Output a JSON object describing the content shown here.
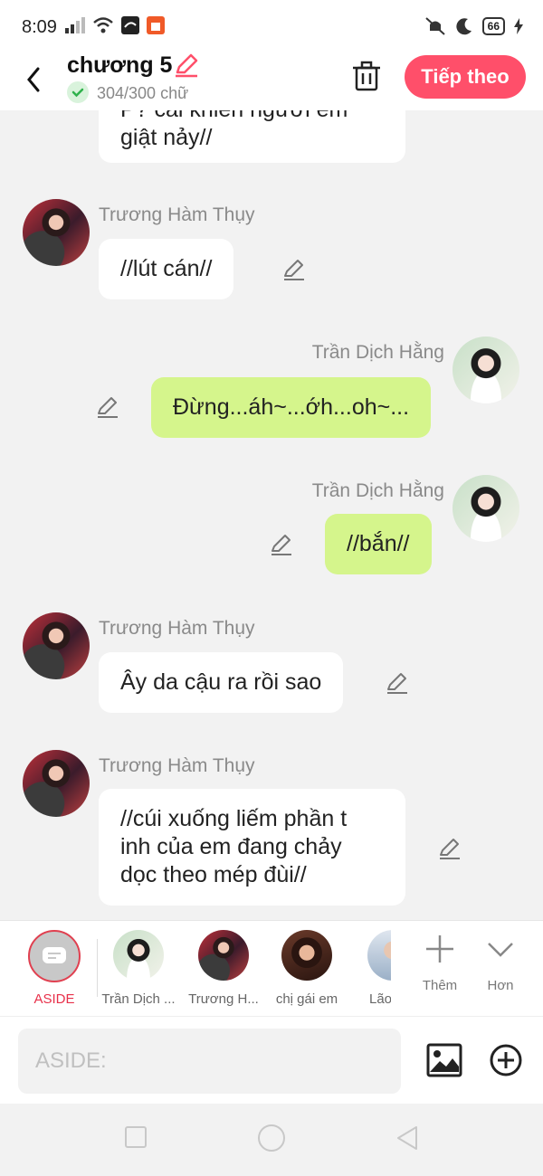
{
  "status_bar": {
    "time": "8:09",
    "battery": "66",
    "icons": [
      "signal-icon",
      "wifi-icon",
      "app-notification-icon",
      "shopping-notification-icon",
      "mute-icon",
      "moon-icon",
      "charging-icon"
    ]
  },
  "header": {
    "title": "chương 5",
    "word_count": "304/300 chữ",
    "next_label": "Tiếp theo",
    "accent_color": "#ff4f6a"
  },
  "messages": [
    {
      "side": "left",
      "name": "",
      "text": "P? cái khiến người em\ngiật nảy//",
      "partial": true
    },
    {
      "side": "left",
      "name": "Trương Hàm Thụy",
      "text": "//lút cán//"
    },
    {
      "side": "right",
      "name": "Trần Dịch Hằng",
      "text": "Đừng...áh~...ớh...oh~..."
    },
    {
      "side": "right",
      "name": "Trần Dịch Hằng",
      "text": "//bắn//"
    },
    {
      "side": "left",
      "name": "Trương Hàm Thụy",
      "text": "Ây da cậu ra rồi sao"
    },
    {
      "side": "left",
      "name": "Trương Hàm Thụy",
      "text": "//cúi xuống liếm phần t\ninh của em đang chảy\ndọc theo mép đùi//"
    }
  ],
  "characters": [
    {
      "label": "ASIDE",
      "selected": true
    },
    {
      "label": "Trần Dịch ..."
    },
    {
      "label": "Trương H..."
    },
    {
      "label": "chị gái em"
    },
    {
      "label": "Lão"
    }
  ],
  "tools": {
    "add_label": "Thêm",
    "more_label": "Hơn"
  },
  "input": {
    "placeholder": "ASIDE:"
  },
  "colors": {
    "green_bubble": "#d5f58c",
    "white_bubble": "#ffffff",
    "background": "#f2f2f2"
  }
}
